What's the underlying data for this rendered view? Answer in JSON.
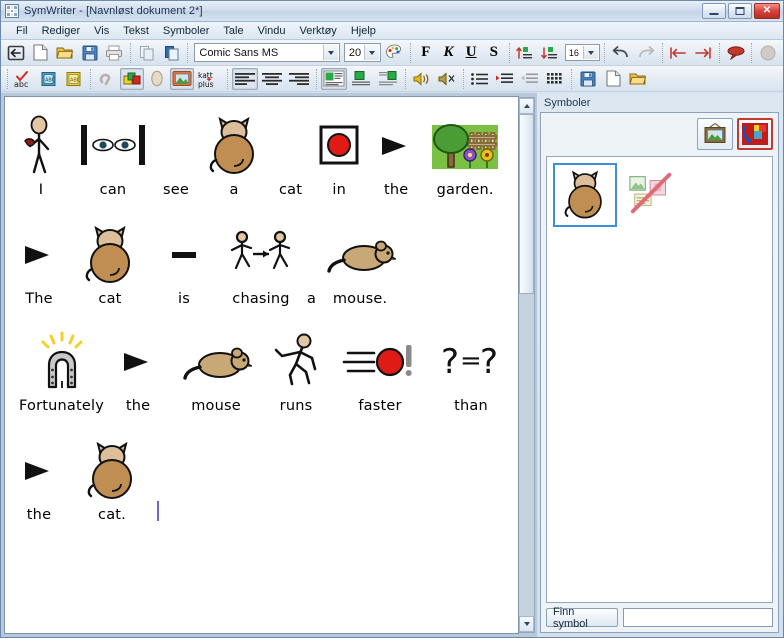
{
  "window": {
    "title": "SymWriter - [Navnløst dokument 2*]",
    "app_icon": "grid-icon",
    "controls": {
      "minimize": "minimize-icon",
      "maximize": "maximize-icon",
      "close": "close-icon"
    }
  },
  "menubar": {
    "items": [
      {
        "label": "Fil"
      },
      {
        "label": "Rediger"
      },
      {
        "label": "Vis"
      },
      {
        "label": "Tekst"
      },
      {
        "label": "Symboler"
      },
      {
        "label": "Tale"
      },
      {
        "label": "Vindu"
      },
      {
        "label": "Verktøy"
      },
      {
        "label": "Hjelp"
      }
    ]
  },
  "toolbar_top": {
    "buttons": [
      {
        "name": "exit-icon"
      },
      {
        "name": "new-document-icon"
      },
      {
        "name": "open-folder-icon"
      },
      {
        "name": "save-icon"
      },
      {
        "name": "print-icon"
      },
      {
        "name": "copy-icon"
      },
      {
        "name": "paste-icon"
      }
    ],
    "font_name": "Comic Sans MS",
    "font_size": "20",
    "color_picker": "color-palette-icon",
    "bold_label": "F",
    "italic_label": "K",
    "underline_label": "U",
    "strikethrough_label": "S",
    "line_spacing_up": "increase-line-spacing-icon",
    "line_spacing_down": "decrease-line-spacing-icon",
    "symbol_size": "16",
    "undo": "undo-icon",
    "redo": "redo-icon",
    "indent_left": "outdent-icon",
    "indent_right": "indent-icon",
    "speech_bubble": "speech-bubble-icon",
    "disabled_round": "disabled-button-icon"
  },
  "toolbar_bottom": {
    "spellcheck": "spellcheck-abc-icon",
    "spellcheck_label": "abc",
    "wordlist_blue": "blue-wordlist-icon",
    "wordlist_yellow": "yellow-wordlist-icon",
    "speech_grey": "speech-grey-icon",
    "symbol_colour": "symbol-colour-icon",
    "skin_tone": "skin-tone-icon",
    "picture": "picture-icon",
    "qualifier_label_top": "katt",
    "qualifier_label_bottom": "plus",
    "align_left": "align-left-icon",
    "align_center": "align-center-icon",
    "align_right": "align-right-icon",
    "symbol_above_text": "symbol-above-text-icon",
    "symbol_text_only": "text-only-icon",
    "symbol_beside_text": "symbol-beside-text-icon",
    "speak_on": "speaker-on-icon",
    "speak_off": "speaker-off-icon",
    "bullets": "bullet-list-icon",
    "indent_plus": "indent-increase-icon",
    "indent_minus": "indent-decrease-icon",
    "grid": "grid-view-icon",
    "save2": "save-icon",
    "new2": "new-document-icon",
    "open2": "open-folder-icon"
  },
  "document": {
    "lines": [
      {
        "words": [
          {
            "text": "I",
            "symbol": "person-walking"
          },
          {
            "text": "can",
            "symbol": "eyes-between-bars"
          },
          {
            "text": "see",
            "symbol": "none"
          },
          {
            "text": "a",
            "symbol": "cat"
          },
          {
            "text": "cat",
            "symbol": "none"
          },
          {
            "text": "in",
            "symbol": "red-ball-in-box"
          },
          {
            "text": "the",
            "symbol": "black-triangle"
          },
          {
            "text": "garden.",
            "symbol": "garden"
          }
        ]
      },
      {
        "words": [
          {
            "text": "The",
            "symbol": "black-triangle"
          },
          {
            "text": "cat",
            "symbol": "cat"
          },
          {
            "text": "is",
            "symbol": "dash"
          },
          {
            "text": "chasing",
            "symbol": "two-runners-chase"
          },
          {
            "text": "a",
            "symbol": "none"
          },
          {
            "text": "mouse.",
            "symbol": "mouse"
          }
        ]
      },
      {
        "words": [
          {
            "text": "Fortunately",
            "symbol": "horseshoe"
          },
          {
            "text": "the",
            "symbol": "black-triangle"
          },
          {
            "text": "mouse",
            "symbol": "mouse"
          },
          {
            "text": "runs",
            "symbol": "runner"
          },
          {
            "text": "faster",
            "symbol": "red-ball-speed"
          },
          {
            "text": "than",
            "symbol": "question-equals-question"
          }
        ]
      },
      {
        "words": [
          {
            "text": "the",
            "symbol": "black-triangle"
          },
          {
            "text": "cat.",
            "symbol": "cat"
          }
        ],
        "caret_after": true
      }
    ]
  },
  "symbol_panel": {
    "title": "Symboler",
    "buttons": [
      {
        "name": "picture-frame-button",
        "selected": false
      },
      {
        "name": "change-symbol-button",
        "selected": true
      }
    ],
    "symbols": [
      {
        "name": "cat-symbol",
        "selected": true
      },
      {
        "name": "no-symbol",
        "selected": false
      }
    ],
    "find_button_label": "Finn symbol",
    "find_input_value": "",
    "find_input_placeholder": ""
  },
  "scrollbar": {
    "up": "scroll-up-arrow",
    "down": "scroll-down-arrow",
    "thumb": "scroll-thumb"
  },
  "colors": {
    "cat_body": "#c08e52",
    "cat_head": "#ddbe9a",
    "mouse_body": "#c8a876",
    "red": "#e01b16",
    "grass": "#7ac043",
    "tree": "#4a9c34",
    "accent_blue": "#3d8fd8",
    "horseshoe": "#b9b9b9",
    "ray_yellow": "#f2d22a"
  }
}
